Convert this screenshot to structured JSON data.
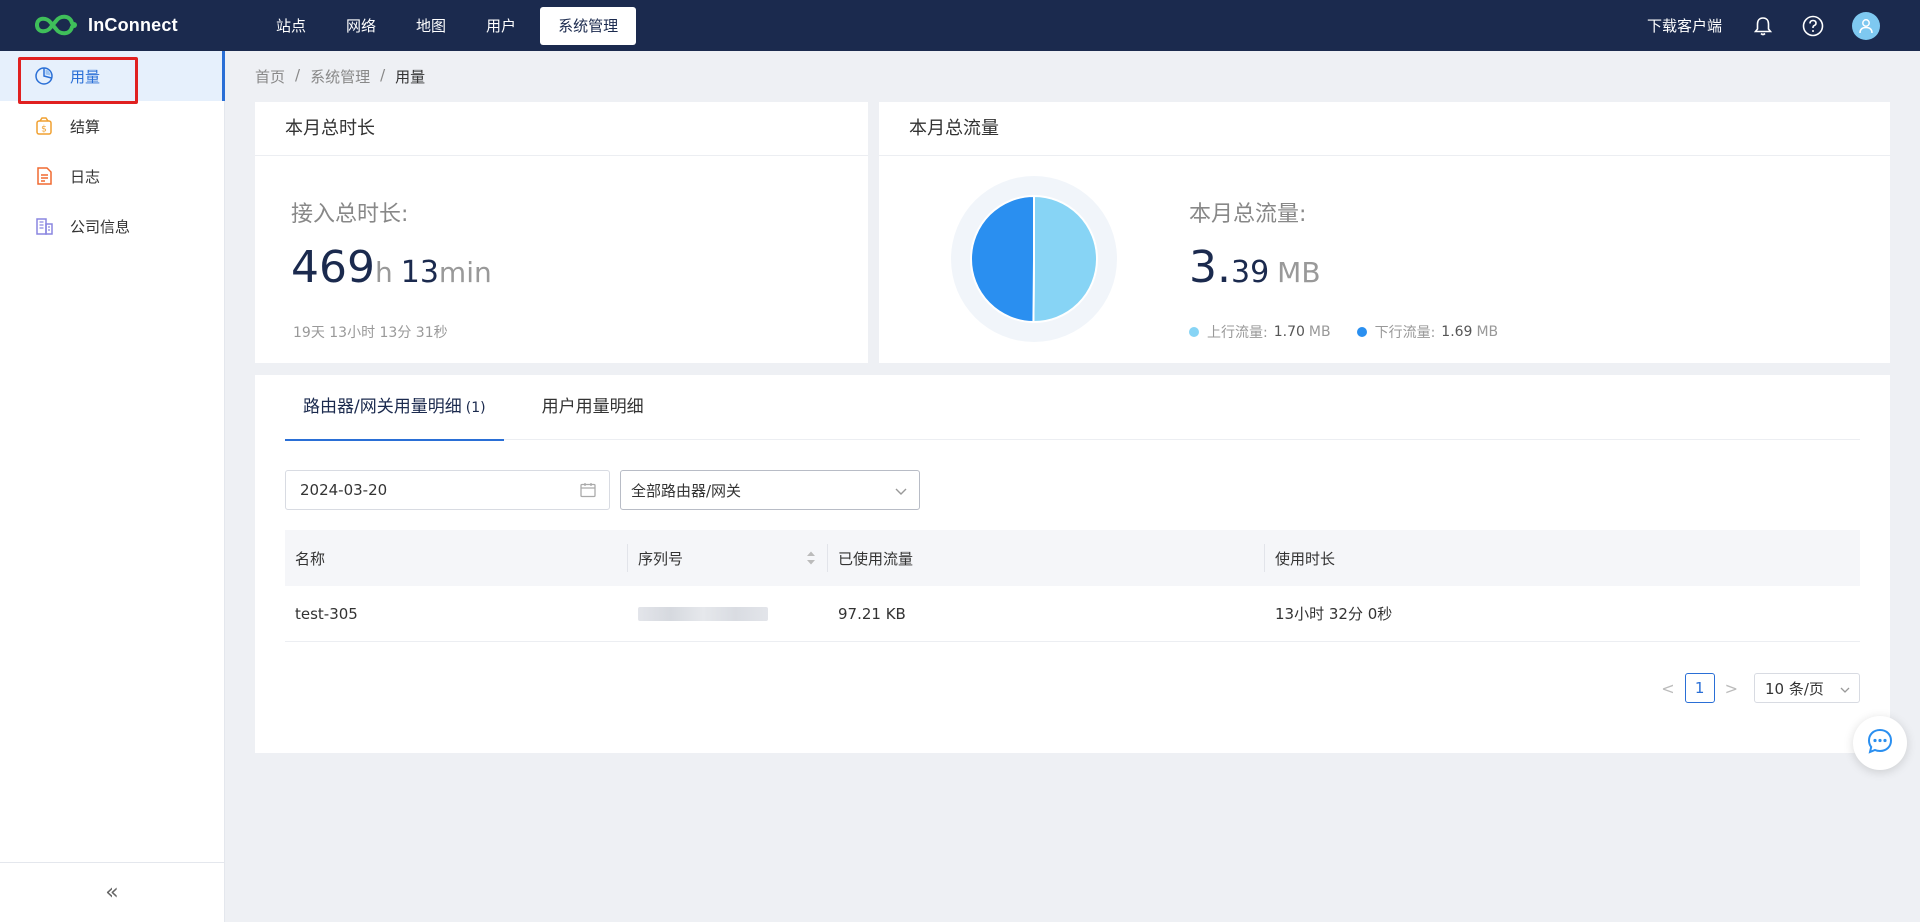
{
  "app": {
    "name": "InConnect"
  },
  "nav": {
    "items": [
      "站点",
      "网络",
      "地图",
      "用户",
      "系统管理"
    ],
    "active": "系统管理"
  },
  "top_right": {
    "download": "下载客户端",
    "icons": [
      "bell-icon",
      "help-icon",
      "user-avatar-icon"
    ]
  },
  "sidebar": {
    "items": [
      {
        "label": "用量",
        "icon": "pie-chart-icon",
        "active": true
      },
      {
        "label": "结算",
        "icon": "billing-icon",
        "active": false
      },
      {
        "label": "日志",
        "icon": "log-icon",
        "active": false
      },
      {
        "label": "公司信息",
        "icon": "company-icon",
        "active": false
      }
    ],
    "collapse_glyph": "«"
  },
  "breadcrumb": {
    "home": "首页",
    "sep": "/",
    "section": "系统管理",
    "current": "用量"
  },
  "duration_card": {
    "title": "本月总时长",
    "label": "接入总时长:",
    "hours": "469",
    "hours_unit": "h",
    "minutes": "13",
    "minutes_unit": "min",
    "detail": "19天 13小时 13分 31秒"
  },
  "traffic_card": {
    "title": "本月总流量",
    "label": "本月总流量:",
    "value_int": "3.",
    "value_dec": "39",
    "unit": "MB",
    "up_label": "上行流量:",
    "up_value": "1.70",
    "up_unit": "MB",
    "down_label": "下行流量:",
    "down_value": "1.69",
    "down_unit": "MB",
    "colors": {
      "up": "#87d4f5",
      "down": "#2a8ff0"
    }
  },
  "chart_data": {
    "type": "pie",
    "categories": [
      "上行流量",
      "下行流量"
    ],
    "values": [
      1.7,
      1.69
    ],
    "title": ""
  },
  "detail": {
    "tabs": [
      {
        "label": "路由器/网关用量明细",
        "count": "(1)",
        "active": true
      },
      {
        "label": "用户用量明细",
        "count": "",
        "active": false
      }
    ],
    "date": "2024-03-20",
    "device_select": "全部路由器/网关",
    "columns": [
      "名称",
      "序列号",
      "已使用流量",
      "使用时长"
    ],
    "rows": [
      {
        "name": "test-305",
        "serial": "",
        "traffic": "97.21 KB",
        "duration": "13小时 32分 0秒"
      }
    ],
    "pager": {
      "prev": "<",
      "page": "1",
      "next": ">",
      "size": "10 条/页"
    }
  }
}
